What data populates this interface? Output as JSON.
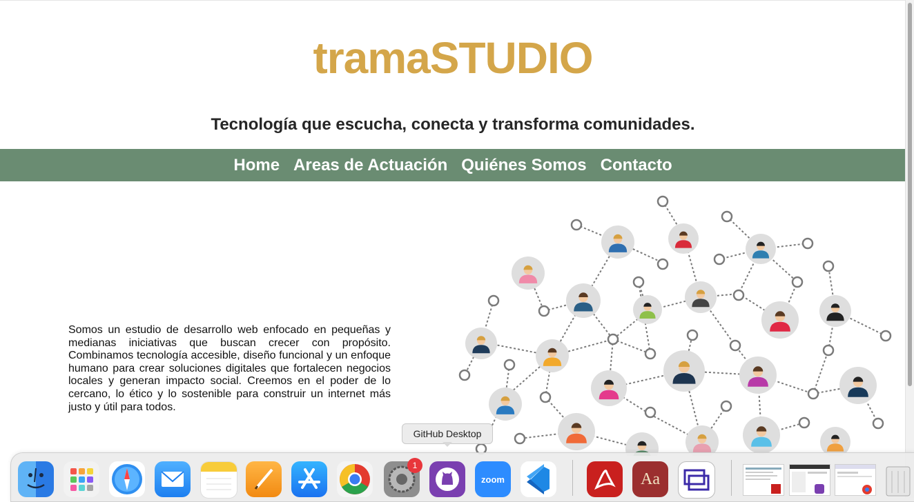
{
  "site": {
    "brand": "tramaSTUDIO",
    "tagline": "Tecnología que escucha, conecta y transforma comunidades."
  },
  "nav": {
    "items": [
      "Home",
      "Areas de Actuación",
      "Quiénes Somos",
      "Contacto"
    ]
  },
  "intro": {
    "text": "Somos un estudio de desarrollo web enfocado en pequeñas y medianas iniciativas que buscan crecer con propósito. Combinamos tecnología accesible, diseño funcional y un enfoque humano para crear soluciones digitales que fortalecen negocios locales y generan impacto social. Creemos en el poder de lo cercano, lo ético y lo sostenible para construir un internet más justo y útil para todos."
  },
  "network_image": {
    "icon": "people-network-illustration"
  },
  "colors": {
    "brand": "#d4a64a",
    "nav_bg": "#6a8c72",
    "nav_text": "#ffffff",
    "tagline": "#262626"
  },
  "dock": {
    "tooltip": "GitHub Desktop",
    "badge_count": "1",
    "apps": [
      {
        "name": "Finder",
        "icon": "finder-icon"
      },
      {
        "name": "Launchpad",
        "icon": "launchpad-icon"
      },
      {
        "name": "Safari",
        "icon": "safari-icon"
      },
      {
        "name": "Mail",
        "icon": "mail-icon"
      },
      {
        "name": "Notes",
        "icon": "notes-icon"
      },
      {
        "name": "Pages",
        "icon": "pages-icon"
      },
      {
        "name": "App Store",
        "icon": "app-store-icon"
      },
      {
        "name": "Chrome",
        "icon": "chrome-icon"
      },
      {
        "name": "System Preferences",
        "icon": "settings-icon"
      },
      {
        "name": "GitHub Desktop",
        "icon": "github-desktop-icon"
      },
      {
        "name": "Zoom",
        "icon": "zoom-icon"
      },
      {
        "name": "VS Code",
        "icon": "vscode-icon"
      },
      {
        "name": "Acrobat",
        "icon": "acrobat-icon"
      },
      {
        "name": "Dictionary",
        "icon": "dictionary-icon"
      },
      {
        "name": "Screen Capture",
        "icon": "screen-capture-icon"
      }
    ],
    "zoom_label": "zoom",
    "dictionary_label": "Aa"
  }
}
